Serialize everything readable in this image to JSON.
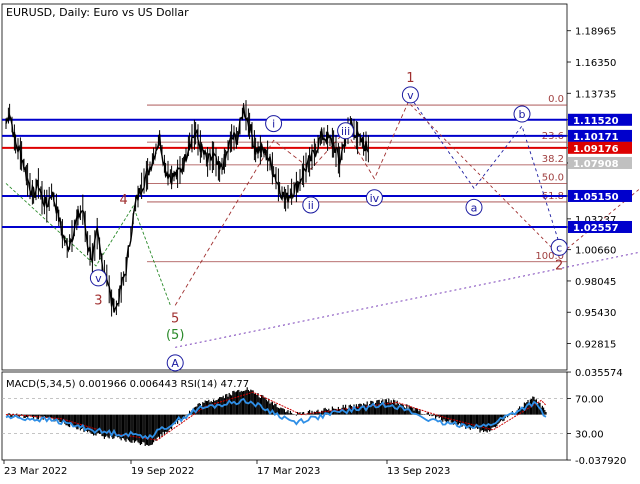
{
  "header": {
    "symbol": "EURUSD",
    "timeframe": "Daily:",
    "description": "Euro vs US Dollar"
  },
  "colors": {
    "candles": "#000000",
    "blue_level": "#0000cc",
    "red_level": "#dd0000",
    "fib_line": "#a04040",
    "wave_circle": "#1a1aa0",
    "wave_red": "#a03030",
    "wave_green": "#2a8a2a",
    "macd_hist": "#000000",
    "macd_signal": "#cc0000",
    "rsi_line": "#2f8fe6"
  },
  "chart_data": [
    {
      "type": "line",
      "title": "",
      "y_axis_ticks": [
        "1.18965",
        "1.16350",
        "1.13735",
        "1.11520",
        "1.10171",
        "1.09176",
        "1.07908",
        "1.05150",
        "1.03237",
        "1.02557",
        "1.00660",
        "0.98045",
        "0.95430",
        "0.92815"
      ],
      "ylim": [
        0.906,
        1.212
      ],
      "x_axis_ticks": [
        "23 Mar 2022",
        "19 Sep 2022",
        "17 Mar 2023",
        "13 Sep 2023"
      ],
      "series": [
        {
          "x_index": [
            0,
            3,
            8,
            13,
            18,
            23,
            27,
            30,
            34,
            38,
            42,
            47,
            51,
            55,
            60,
            64,
            68,
            72,
            76,
            80,
            84,
            88,
            92,
            96,
            100,
            104,
            108,
            113,
            118,
            123,
            128,
            133,
            138,
            143,
            148,
            153,
            158,
            163,
            168,
            173,
            178,
            183,
            188,
            193,
            198,
            203,
            208,
            213,
            218,
            223,
            228,
            233,
            238,
            243,
            248,
            253,
            258,
            263,
            268,
            273,
            278,
            283,
            288,
            293,
            298,
            303
          ],
          "values": [
            1.112,
            1.122,
            1.095,
            1.085,
            1.065,
            1.052,
            1.062,
            1.05,
            1.043,
            1.055,
            1.042,
            1.02,
            1.008,
            1.018,
            1.035,
            1.04,
            1.012,
            1.0,
            1.02,
            0.995,
            0.985,
            0.962,
            0.958,
            0.975,
            0.99,
            1.02,
            1.045,
            1.06,
            1.07,
            1.085,
            1.1,
            1.073,
            1.067,
            1.07,
            1.078,
            1.097,
            1.104,
            1.09,
            1.08,
            1.085,
            1.072,
            1.083,
            1.1,
            1.1,
            1.125,
            1.11,
            1.09,
            1.09,
            1.085,
            1.072,
            1.058,
            1.048,
            1.055,
            1.06,
            1.072,
            1.08,
            1.09,
            1.102,
            1.1,
            1.095,
            1.08,
            1.102,
            1.112,
            1.1,
            1.095,
            1.09
          ]
        }
      ],
      "price_labels": [
        {
          "text": "1.11520",
          "value": 1.1152,
          "style": "blue"
        },
        {
          "text": "1.10171",
          "value": 1.10171,
          "style": "blue"
        },
        {
          "text": "1.09176",
          "value": 1.09176,
          "style": "red"
        },
        {
          "text": "1.07908",
          "value": 1.07908,
          "style": "gray"
        },
        {
          "text": "1.05150",
          "value": 1.0515,
          "style": "blue"
        },
        {
          "text": "1.02557",
          "value": 1.02557,
          "style": "blue"
        }
      ],
      "fibonacci": [
        {
          "label": "0.0",
          "value": 1.1275
        },
        {
          "label": "23.6",
          "value": 1.0965
        },
        {
          "label": "38.2",
          "value": 1.0775
        },
        {
          "label": "50.0",
          "value": 1.062
        },
        {
          "label": "61.8",
          "value": 1.0465
        },
        {
          "label": "100.0",
          "value": 0.9965
        }
      ],
      "wave_labels": {
        "circled": [
          {
            "text": "v",
            "x_index": 77,
            "value": 0.983
          },
          {
            "text": "A",
            "x_index": 141,
            "value": 0.912
          },
          {
            "text": "i",
            "x_index": 223,
            "value": 1.112
          },
          {
            "text": "ii",
            "x_index": 254,
            "value": 1.044
          },
          {
            "text": "iii",
            "x_index": 283,
            "value": 1.106
          },
          {
            "text": "iv",
            "x_index": 307,
            "value": 1.05
          },
          {
            "text": "v",
            "x_index": 337,
            "value": 1.136
          },
          {
            "text": "a",
            "x_index": 390,
            "value": 1.042
          },
          {
            "text": "b",
            "x_index": 430,
            "value": 1.12
          },
          {
            "text": "c",
            "x_index": 461,
            "value": 1.0085
          }
        ],
        "plain": [
          {
            "text": "4",
            "x_index": 98,
            "value": 1.049,
            "style": "red"
          },
          {
            "text": "3",
            "x_index": 77,
            "value": 0.965,
            "style": "red"
          },
          {
            "text": "5",
            "x_index": 141,
            "value": 0.95,
            "style": "red"
          },
          {
            "text": "(5)",
            "x_index": 141,
            "value": 0.936,
            "style": "green"
          },
          {
            "text": "1",
            "x_index": 337,
            "value": 1.151,
            "style": "red"
          },
          {
            "text": "2",
            "x_index": 461,
            "value": 0.994,
            "style": "red"
          }
        ]
      }
    },
    {
      "type": "bar",
      "title": "MACD(5,34,5) 0.001966 0.006443 RSI(14) 47.77",
      "y_axis_ticks": [
        "0.035574",
        "70.00",
        "30.00",
        "-0.037920"
      ],
      "ylim": [
        -0.0379,
        0.0356
      ],
      "series": [
        {
          "name": "MACD",
          "x_index": [
            0,
            40,
            80,
            120,
            160,
            200,
            240,
            280,
            320,
            360,
            400,
            440,
            450
          ],
          "values": [
            0.0,
            -0.004,
            -0.018,
            -0.025,
            0.008,
            0.022,
            0.0,
            0.006,
            0.012,
            -0.003,
            -0.015,
            0.014,
            0.002
          ]
        },
        {
          "name": "RSI",
          "x_index": [
            0,
            40,
            80,
            120,
            160,
            200,
            240,
            280,
            320,
            360,
            400,
            440,
            450
          ],
          "values": [
            49,
            45,
            32,
            27,
            58,
            68,
            43,
            55,
            64,
            42,
            38,
            65,
            47.77
          ]
        }
      ]
    }
  ]
}
